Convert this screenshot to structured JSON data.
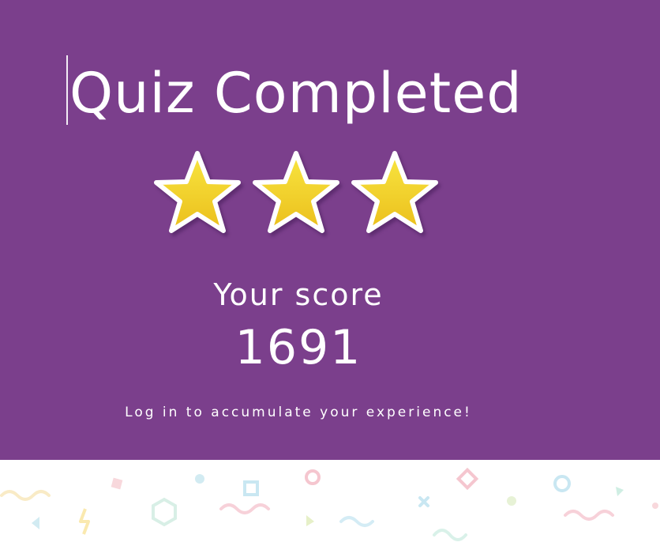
{
  "result": {
    "title": "Quiz Completed",
    "stars_earned": 3,
    "stars_total": 3,
    "score_label": "Your score",
    "score_value": "1691",
    "login_hint": "Log in to accumulate your experience!"
  },
  "colors": {
    "panel_background": "#7b3f8c",
    "text": "#ffffff",
    "star_fill_top": "#f7e23a",
    "star_fill_bottom": "#ecc21f",
    "star_outline": "#ffffff",
    "confetti_background": "#ffffff"
  },
  "icons": {
    "star": "star-icon",
    "confetti": "confetti-decoration"
  }
}
